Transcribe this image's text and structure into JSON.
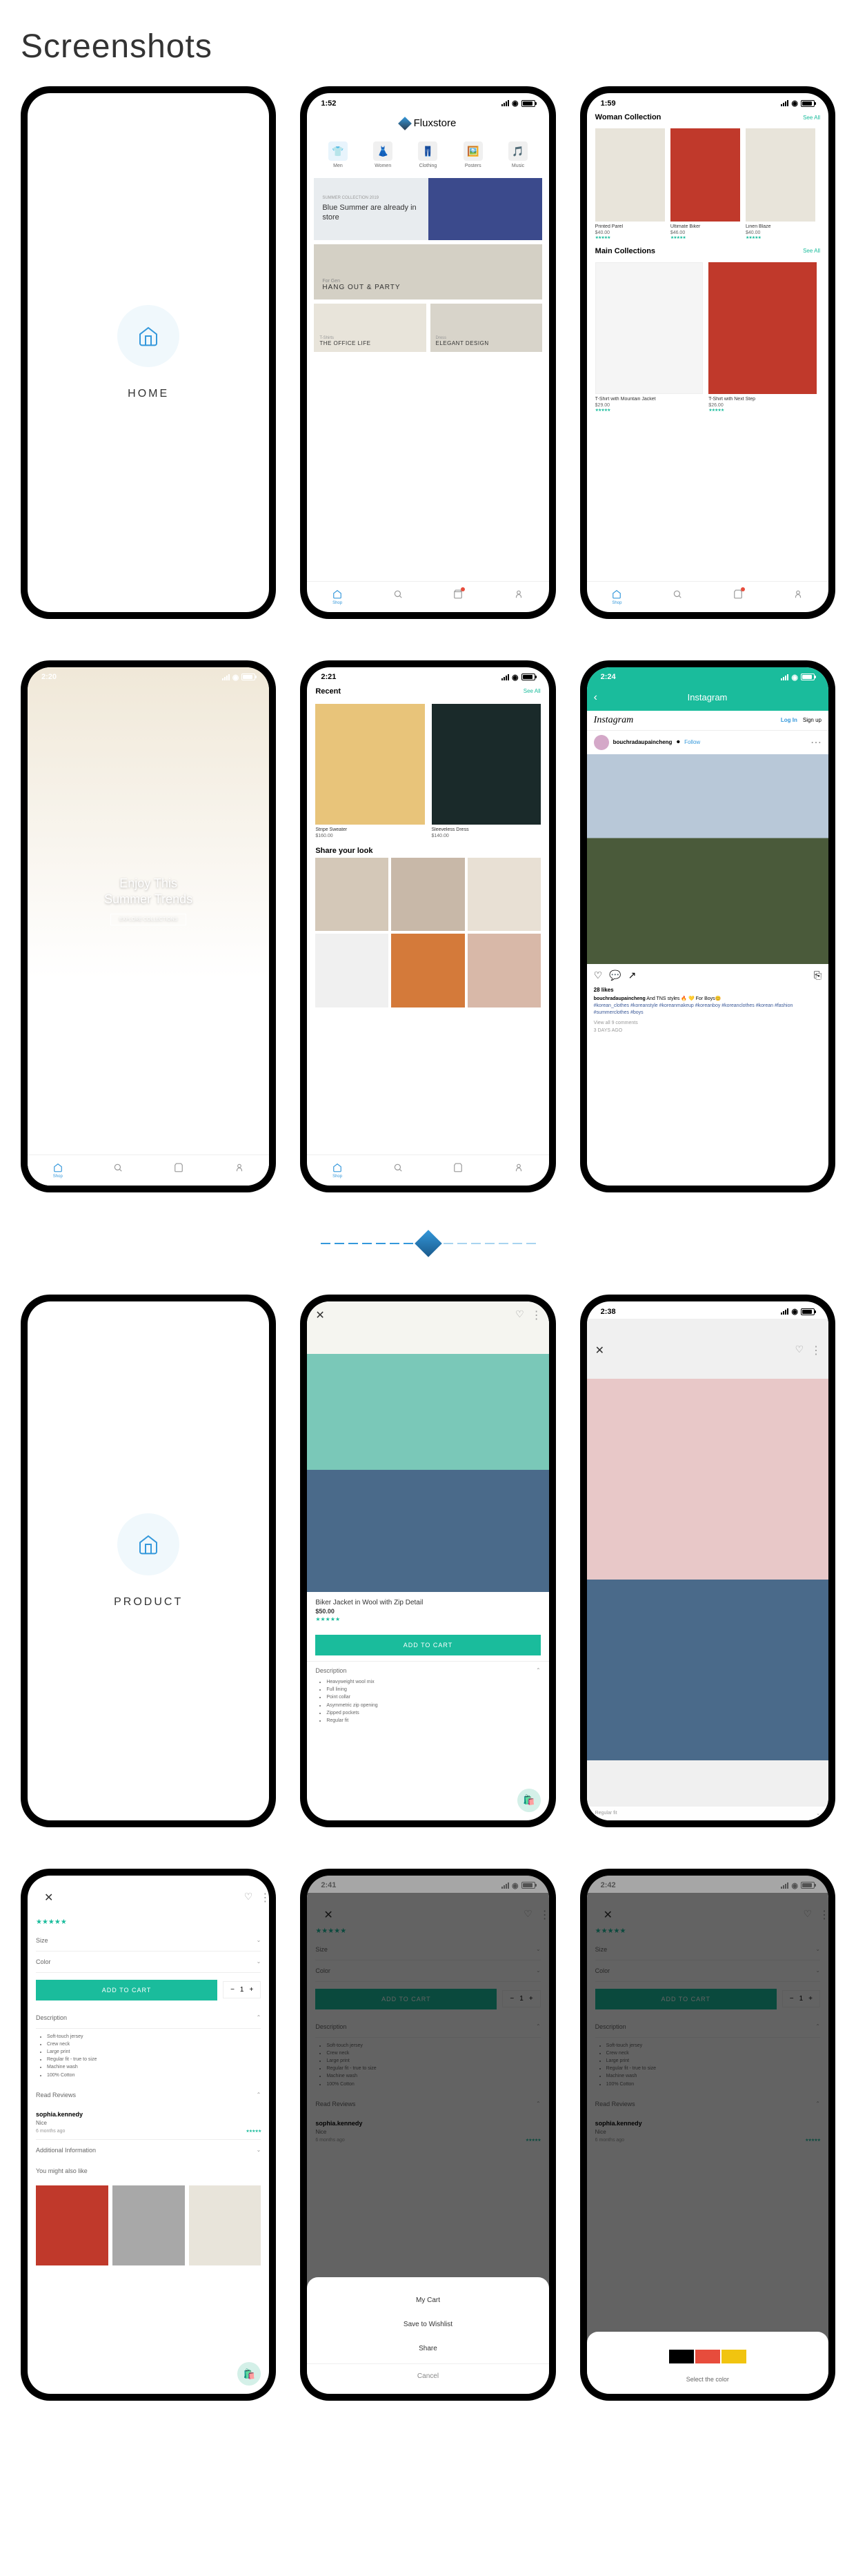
{
  "page_title": "Screenshots",
  "times": {
    "t152": "1:52",
    "t159": "1:59",
    "t220": "2:20",
    "t221": "2:21",
    "t224": "2:24",
    "t238": "2:38",
    "t241": "2:41",
    "t242": "2:42"
  },
  "splash": {
    "home": "HOME",
    "product": "PRODUCT"
  },
  "fluxstore": {
    "name": "Fluxstore",
    "categories": [
      {
        "label": "Men",
        "icon": "👕"
      },
      {
        "label": "Women",
        "icon": "👗"
      },
      {
        "label": "Clothing",
        "icon": "👖"
      },
      {
        "label": "Posters",
        "icon": "🖼️"
      },
      {
        "label": "Music",
        "icon": "🎵"
      }
    ],
    "promo1_sub": "SUMMER COLLECTION 2019",
    "promo1_title": "Blue Summer are already in store",
    "promo2_sub": "For Gen",
    "promo2_title": "HANG OUT & PARTY",
    "col1_sub": "T-Shirts",
    "col1_title": "THE OFFICE LIFE",
    "col2_sub": "Dress",
    "col2_title": "ELEGANT DESIGN"
  },
  "nav": {
    "shop": "Shop"
  },
  "collection": {
    "woman_title": "Woman Collection",
    "see_all": "See All",
    "main_title": "Main Collections",
    "products": [
      {
        "name": "Printed Parel",
        "price": "$40.00"
      },
      {
        "name": "Ultimate Biker",
        "price": "$46.00"
      },
      {
        "name": "Linen Blaze",
        "price": "$40.00"
      }
    ],
    "main_products": [
      {
        "name": "T-Shirt with Mountain Jacket",
        "price": "$29.00"
      },
      {
        "name": "T-Shirt with Next Step",
        "price": "$26.00"
      }
    ]
  },
  "trends": {
    "title_l1": "Enjoy This",
    "title_l2": "Summer Trends",
    "btn": "EXPLORE COLLECTIONS"
  },
  "recent": {
    "title": "Recent",
    "see_all": "See All",
    "items": [
      {
        "name": "Stripe Sweater",
        "price": "$160.00"
      },
      {
        "name": "Sleeveless Dress",
        "price": "$140.00"
      }
    ],
    "share_title": "Share your look"
  },
  "instagram": {
    "header": "Instagram",
    "logo": "Instagram",
    "login": "Log In",
    "signup": "Sign up",
    "username": "bouchradaupaincheng",
    "follow": "Follow",
    "likes": "28 likes",
    "caption_user": "bouchradaupaincheng",
    "caption_text": "And TNS styles 🔥 💛 For Boys😊",
    "tags": "#korean_clothes #koreanstyle #koreanmakeup #koreanboy #koreanclothes #korean #fashion #summerclothes #boys",
    "view_comments": "View all 9 comments",
    "time_ago": "3 DAYS AGO"
  },
  "product_detail": {
    "name": "Biker Jacket in Wool with Zip Detail",
    "price": "$50.00",
    "add_to_cart": "ADD TO CART",
    "description_label": "Description",
    "bullets": [
      "Heavyweight wool mix",
      "Full lining",
      "Point collar",
      "Asymmetric zip opening",
      "Zipped pockets",
      "Regular fit"
    ],
    "regular_fit": "Regular fit"
  },
  "options": {
    "size_label": "Size",
    "color_label": "Color",
    "add_to_cart": "ADD TO CART",
    "qty": "1",
    "description": "Description",
    "bullets": [
      "Soft-touch jersey",
      "Crew neck",
      "Large print",
      "Regular fit - true to size",
      "Machine wash",
      "100% Cotton"
    ],
    "reviews_label": "Read Reviews",
    "review_user": "sophia.kennedy",
    "review_text": "Nice",
    "review_time": "6 months ago",
    "additional_label": "Additional Information",
    "also_like_label": "You might also like"
  },
  "action_sheet": {
    "my_cart": "My Cart",
    "save_wishlist": "Save to Wishlist",
    "share": "Share",
    "cancel": "Cancel"
  },
  "color_sheet": {
    "title": "Select the color"
  }
}
